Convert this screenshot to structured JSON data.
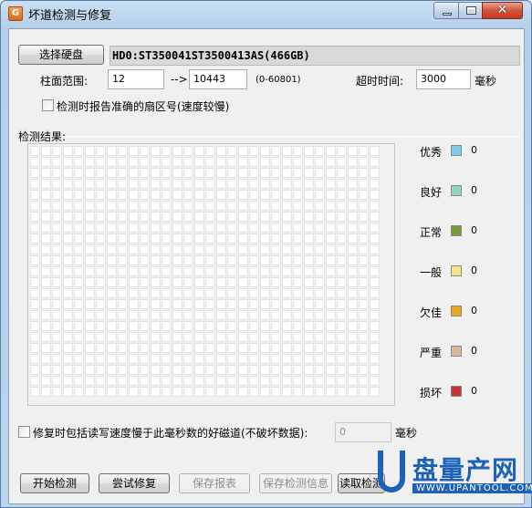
{
  "window": {
    "title": "坏道检测与修复",
    "app_icon_glyph": "G",
    "close_glyph": "✕"
  },
  "disk": {
    "select_button": "选择硬盘",
    "name": "HD0:ST350041ST3500413AS(466GB)"
  },
  "range": {
    "label": "柱面范围:",
    "start": "12",
    "arrow": "-->",
    "end": "10443",
    "hint": "(0-60801)"
  },
  "timeout": {
    "label": "超时时间:",
    "value": "3000",
    "unit": "毫秒"
  },
  "options": {
    "report_sector_label": "检测时报告准确的扇区号(速度较慢)",
    "repair_slow_label": "修复时包括读写速度慢于此毫秒数的好磁道(不破坏数据):",
    "repair_slow_value": "0",
    "repair_slow_unit": "毫秒"
  },
  "results": {
    "label": "检测结果:",
    "grid_columns": 32,
    "grid_rows": 23
  },
  "legend": [
    {
      "label": "优秀",
      "color": "#7ec8e8",
      "count": "0"
    },
    {
      "label": "良好",
      "color": "#8dd6c6",
      "count": "0"
    },
    {
      "label": "正常",
      "color": "#7a9a3a",
      "count": "0"
    },
    {
      "label": "一般",
      "color": "#f4e58a",
      "count": "0"
    },
    {
      "label": "欠佳",
      "color": "#e8a626",
      "count": "0"
    },
    {
      "label": "严重",
      "color": "#d8b898",
      "count": "0"
    },
    {
      "label": "损坏",
      "color": "#c83232",
      "count": "0"
    }
  ],
  "actions": {
    "start": "开始检测",
    "try_repair": "尝试修复",
    "save_report": "保存报表",
    "save_info": "保存检测信息",
    "load": "读取检测"
  },
  "watermark": {
    "brand": "盘量产网",
    "url": "WWW.UPANTOOL.COM"
  }
}
